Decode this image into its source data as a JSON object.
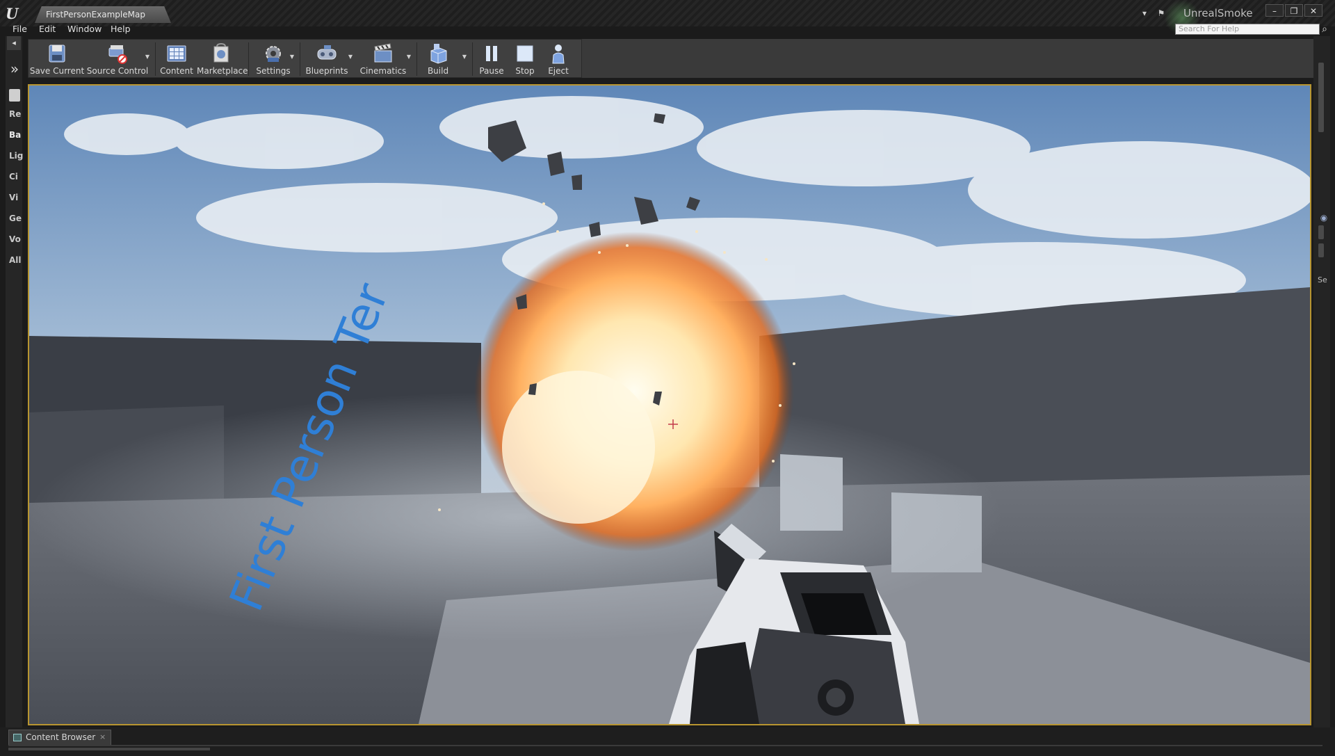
{
  "window": {
    "document_tab": "FirstPersonExampleMap",
    "project_name": "UnrealSmoke",
    "help_search_placeholder": "Search For Help",
    "controls": {
      "minimize": "–",
      "restore": "❐",
      "close": "✕"
    }
  },
  "menu": [
    "File",
    "Edit",
    "Window",
    "Help"
  ],
  "left_panel": {
    "categories": [
      "Re",
      "Ba",
      "Lig",
      "Ci",
      "Vi",
      "Ge",
      "Vo",
      "All"
    ],
    "active_index": 1,
    "expand_glyph": "»"
  },
  "toolbar": {
    "buttons": [
      {
        "label": "Save Current",
        "icon": "save-icon"
      },
      {
        "label": "Source Control",
        "icon": "source-control-icon"
      },
      {
        "label": "Content",
        "icon": "content-icon"
      },
      {
        "label": "Marketplace",
        "icon": "marketplace-icon"
      },
      {
        "label": "Settings",
        "icon": "settings-icon"
      },
      {
        "label": "Blueprints",
        "icon": "blueprints-icon"
      },
      {
        "label": "Cinematics",
        "icon": "cinematics-icon"
      },
      {
        "label": "Build",
        "icon": "build-icon"
      },
      {
        "label": "Pause",
        "icon": "pause-icon"
      },
      {
        "label": "Stop",
        "icon": "stop-icon"
      },
      {
        "label": "Eject",
        "icon": "eject-icon"
      }
    ]
  },
  "viewport": {
    "floor_text": "First Person Ter",
    "accent_color": "#b89530"
  },
  "right_panel": {
    "label": "Se"
  },
  "bottom": {
    "tab_label": "Content Browser",
    "close_glyph": "×"
  }
}
